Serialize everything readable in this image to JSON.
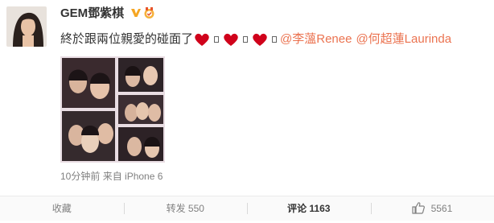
{
  "post": {
    "username": "GEM鄧紫棋",
    "verified_badge": "verified-v-icon",
    "text_main": "終於跟兩位親愛的碰面了",
    "mentions": [
      "@李薀Renee",
      "@何超蓮Laurinda"
    ],
    "timestamp": "10分钟前",
    "source": "来自 iPhone 6"
  },
  "actions": {
    "collect": "收藏",
    "repost": "转发 550",
    "comment": "评论 1163",
    "like": "5561"
  },
  "colors": {
    "mention": "#eb7350",
    "heart": "#d0021b",
    "verified": "#f5a623"
  }
}
